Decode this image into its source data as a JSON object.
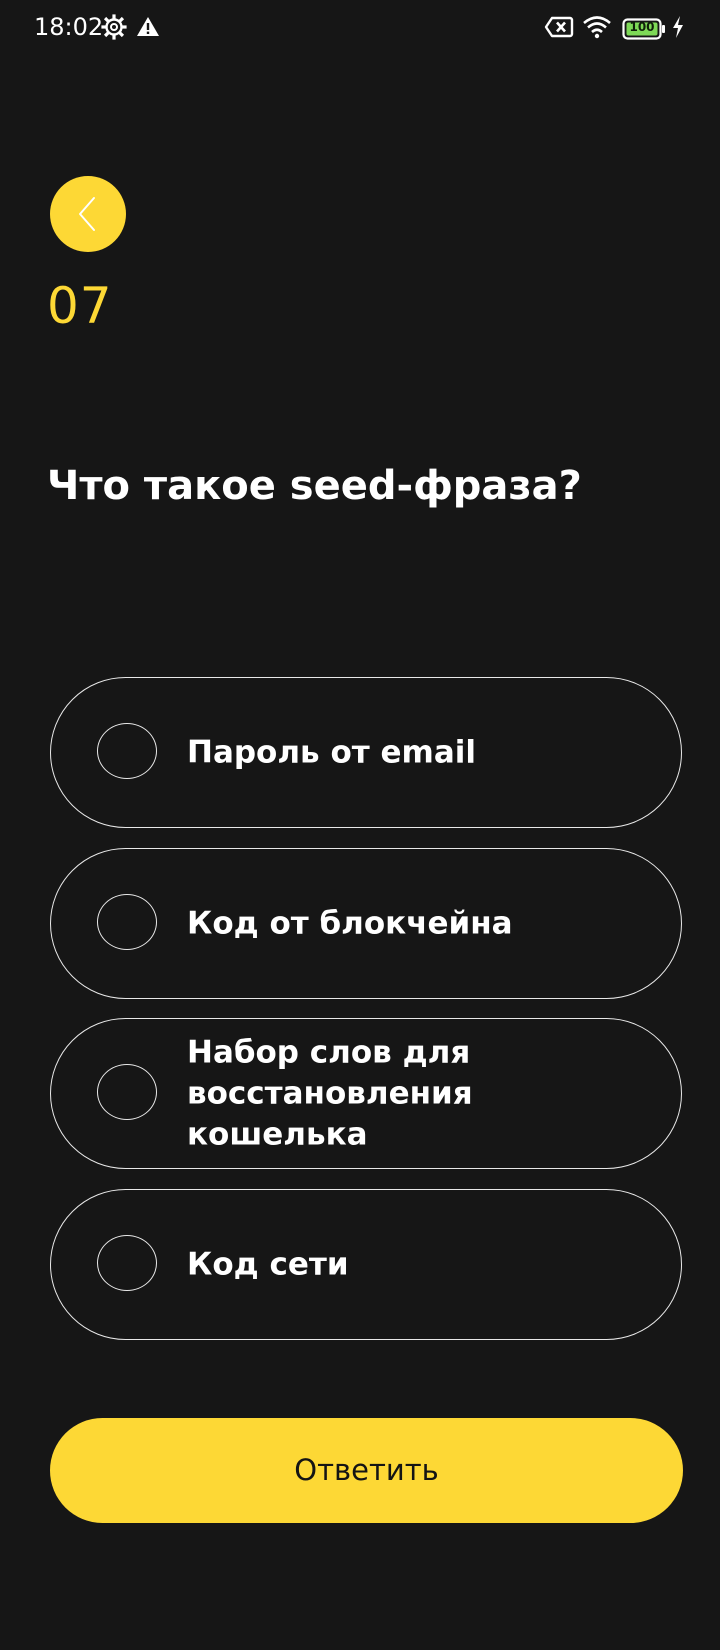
{
  "status_bar": {
    "time": "18:02",
    "battery_level": "100",
    "icons": [
      "settings-gear-icon",
      "warning-triangle-icon",
      "no-sim-icon",
      "wifi-icon",
      "battery-icon",
      "charging-bolt-icon"
    ]
  },
  "quiz": {
    "step": "07",
    "question": "Что такое seed-фраза?",
    "options": [
      {
        "label": "Пароль от email",
        "selected": false
      },
      {
        "label": "Код от блокчейна",
        "selected": false
      },
      {
        "label": "Набор слов для восстановления кошелька",
        "selected": false
      },
      {
        "label": "Код сети",
        "selected": false
      }
    ],
    "submit_label": "Ответить"
  },
  "colors": {
    "background": "#161616",
    "accent": "#fdd835",
    "text": "#ffffff",
    "outline": "#e8e8e8",
    "battery_fill": "#7ed957"
  },
  "icons": {
    "back": "chevron-left-icon"
  }
}
